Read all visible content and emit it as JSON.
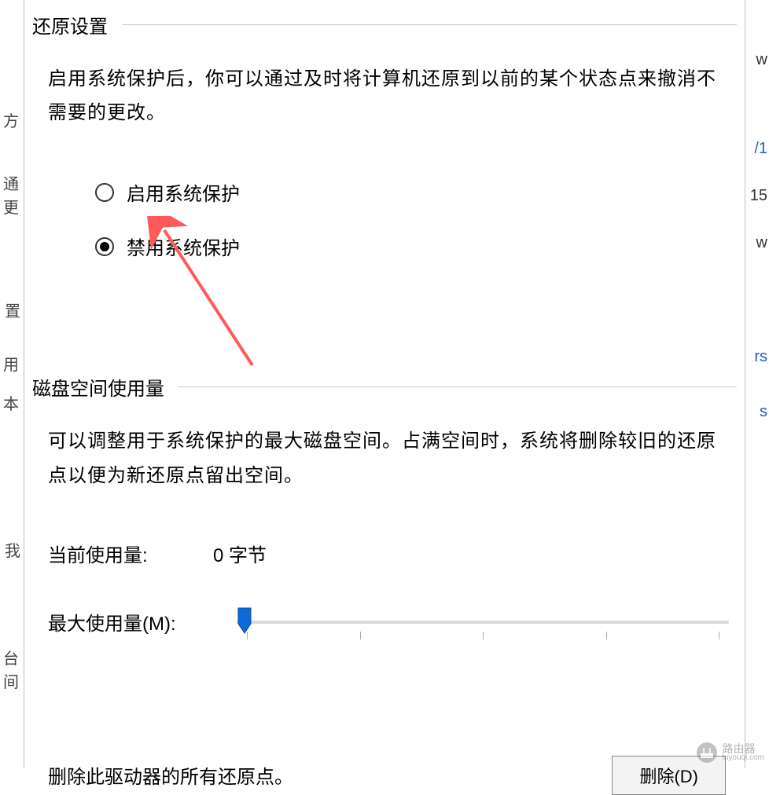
{
  "restore": {
    "title": "还原设置",
    "description": "启用系统保护后，你可以通过及时将计算机还原到以前的某个状态点来撤消不需要的更改。",
    "radio_enable": "启用系统保护",
    "radio_disable": "禁用系统保护",
    "selected": "disable"
  },
  "disk": {
    "title": "磁盘空间使用量",
    "description": "可以调整用于系统保护的最大磁盘空间。占满空间时，系统将删除较旧的还原点以便为新还原点留出空间。",
    "current_label": "当前使用量:",
    "current_value": "0 字节",
    "max_label": "最大使用量(M):",
    "slider_percent": 0
  },
  "delete": {
    "text": "删除此驱动器的所有还原点。",
    "button": "删除(D)"
  },
  "watermark": {
    "brand": "路由器",
    "url": "luyouqi.com"
  },
  "background_fragments": {
    "left": [
      "方",
      "通",
      "更",
      "置",
      "用",
      "本",
      "我",
      "台",
      "间"
    ],
    "right": [
      "w",
      "/1",
      "15",
      "w",
      "rs",
      "s"
    ]
  }
}
